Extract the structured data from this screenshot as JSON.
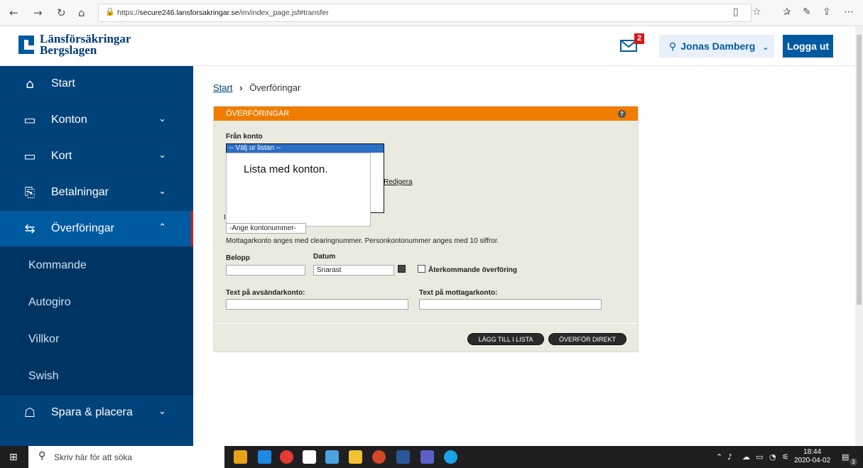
{
  "browser": {
    "url_prefix": "https://",
    "url_host": "secure246.lansforsakringar.se",
    "url_path": "/im/index_page.jsf#transfer"
  },
  "header": {
    "logo_line1": "Länsförsäkringar",
    "logo_line2": "Bergslagen",
    "mail_badge": "2",
    "user_name": "Jonas Damberg",
    "logout_label": "Logga ut"
  },
  "sidebar": {
    "items": [
      {
        "label": "Start"
      },
      {
        "label": "Konton"
      },
      {
        "label": "Kort"
      },
      {
        "label": "Betalningar"
      },
      {
        "label": "Överföringar"
      }
    ],
    "subitems": [
      "Kommande",
      "Autogiro",
      "Villkor",
      "Swish"
    ],
    "last_item": {
      "label": "Spara & placera"
    }
  },
  "breadcrumb": {
    "home": "Start",
    "separator": "›",
    "current": "Överföringar"
  },
  "form": {
    "panel_title": "ÖVERFÖRINGAR",
    "help_icon": "?",
    "from_label": "Från konto",
    "from_selected": "-- Välj ur listan --",
    "overlay_note": "Lista med konton.",
    "edit_link": "Redigera",
    "to_label": "I",
    "to_placeholder": "-Ange kontonummer-",
    "to_hint": "Mottagarkonto anges med clearingnummer. Personkontonummer anges med 10 siffror.",
    "amount_label": "Belopp",
    "date_label": "Datum",
    "date_value": "Snarast",
    "recurring_label": "Återkommande överföring",
    "sender_text_label": "Text på avsändarkonto:",
    "receiver_text_label": "Text på mottagarkonto:",
    "add_to_list_button": "LÄGG TILL I LISTA",
    "transfer_now_button": "ÖVERFÖR DIREKT"
  },
  "taskbar": {
    "search_placeholder": "Skriv här för att söka",
    "time": "18:44",
    "date": "2020-04-02",
    "notification_count": "3"
  },
  "colors": {
    "sidebar_bg": "#00427a",
    "brand_blue": "#005aa0",
    "panel_header_orange": "#f07d00",
    "panel_bg": "#ebeae0",
    "badge_red": "#d7191c"
  }
}
